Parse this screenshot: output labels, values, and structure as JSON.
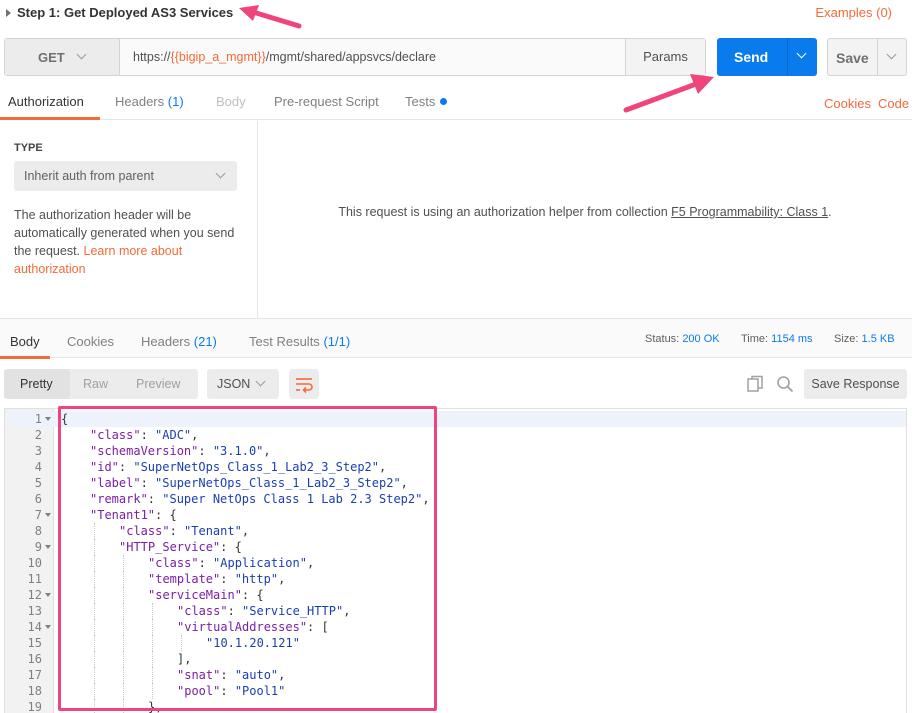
{
  "request": {
    "title": "Step 1: Get Deployed AS3 Services",
    "examples_label": "Examples (0)",
    "method": "GET",
    "url_prefix": "https://",
    "url_variable": "{{bigip_a_mgmt}}",
    "url_suffix": "/mgmt/shared/appsvcs/declare",
    "params_label": "Params",
    "send_label": "Send",
    "save_label": "Save"
  },
  "request_tabs": {
    "authorization": "Authorization",
    "headers": "Headers",
    "headers_count": "(1)",
    "body": "Body",
    "pre_request": "Pre-request Script",
    "tests": "Tests",
    "cookies": "Cookies",
    "code": "Code"
  },
  "auth": {
    "type_label": "TYPE",
    "selected": "Inherit auth from parent",
    "description": "The authorization header will be automatically generated when you send the request. ",
    "learn_more": "Learn more about authorization",
    "helper_message": "This request is using an authorization helper from collection ",
    "collection_name": "F5 Programmability: Class 1",
    "helper_suffix": "."
  },
  "response_tabs": {
    "body": "Body",
    "cookies": "Cookies",
    "headers": "Headers",
    "headers_count": "(21)",
    "test_results": "Test Results",
    "test_results_count": "(1/1)"
  },
  "response_status": {
    "status_label": "Status:",
    "status_value": "200 OK",
    "time_label": "Time:",
    "time_value": "1154 ms",
    "size_label": "Size:",
    "size_value": "1.5 KB"
  },
  "body_toolbar": {
    "pretty": "Pretty",
    "raw": "Raw",
    "preview": "Preview",
    "format": "JSON",
    "save_response": "Save Response"
  },
  "code_lines": [
    {
      "n": "1",
      "fold": true,
      "indent": 0,
      "parts": [
        [
          "p",
          "{"
        ]
      ]
    },
    {
      "n": "2",
      "fold": false,
      "indent": 1,
      "parts": [
        [
          "k",
          "\"class\""
        ],
        [
          "p",
          ": "
        ],
        [
          "s",
          "\"ADC\""
        ],
        [
          "p",
          ","
        ]
      ]
    },
    {
      "n": "3",
      "fold": false,
      "indent": 1,
      "parts": [
        [
          "k",
          "\"schemaVersion\""
        ],
        [
          "p",
          ": "
        ],
        [
          "s",
          "\"3.1.0\""
        ],
        [
          "p",
          ","
        ]
      ]
    },
    {
      "n": "4",
      "fold": false,
      "indent": 1,
      "parts": [
        [
          "k",
          "\"id\""
        ],
        [
          "p",
          ": "
        ],
        [
          "s",
          "\"SuperNetOps_Class_1_Lab2_3_Step2\""
        ],
        [
          "p",
          ","
        ]
      ]
    },
    {
      "n": "5",
      "fold": false,
      "indent": 1,
      "parts": [
        [
          "k",
          "\"label\""
        ],
        [
          "p",
          ": "
        ],
        [
          "s",
          "\"SuperNetOps_Class_1_Lab2_3_Step2\""
        ],
        [
          "p",
          ","
        ]
      ]
    },
    {
      "n": "6",
      "fold": false,
      "indent": 1,
      "parts": [
        [
          "k",
          "\"remark\""
        ],
        [
          "p",
          ": "
        ],
        [
          "s",
          "\"Super NetOps Class 1 Lab 2.3 Step2\""
        ],
        [
          "p",
          ","
        ]
      ]
    },
    {
      "n": "7",
      "fold": true,
      "indent": 1,
      "parts": [
        [
          "k",
          "\"Tenant1\""
        ],
        [
          "p",
          ": {"
        ]
      ]
    },
    {
      "n": "8",
      "fold": false,
      "indent": 2,
      "parts": [
        [
          "k",
          "\"class\""
        ],
        [
          "p",
          ": "
        ],
        [
          "s",
          "\"Tenant\""
        ],
        [
          "p",
          ","
        ]
      ]
    },
    {
      "n": "9",
      "fold": true,
      "indent": 2,
      "parts": [
        [
          "k",
          "\"HTTP_Service\""
        ],
        [
          "p",
          ": {"
        ]
      ]
    },
    {
      "n": "10",
      "fold": false,
      "indent": 3,
      "parts": [
        [
          "k",
          "\"class\""
        ],
        [
          "p",
          ": "
        ],
        [
          "s",
          "\"Application\""
        ],
        [
          "p",
          ","
        ]
      ]
    },
    {
      "n": "11",
      "fold": false,
      "indent": 3,
      "parts": [
        [
          "k",
          "\"template\""
        ],
        [
          "p",
          ": "
        ],
        [
          "s",
          "\"http\""
        ],
        [
          "p",
          ","
        ]
      ]
    },
    {
      "n": "12",
      "fold": true,
      "indent": 3,
      "parts": [
        [
          "k",
          "\"serviceMain\""
        ],
        [
          "p",
          ": {"
        ]
      ]
    },
    {
      "n": "13",
      "fold": false,
      "indent": 4,
      "parts": [
        [
          "k",
          "\"class\""
        ],
        [
          "p",
          ": "
        ],
        [
          "s",
          "\"Service_HTTP\""
        ],
        [
          "p",
          ","
        ]
      ]
    },
    {
      "n": "14",
      "fold": true,
      "indent": 4,
      "parts": [
        [
          "k",
          "\"virtualAddresses\""
        ],
        [
          "p",
          ": ["
        ]
      ]
    },
    {
      "n": "15",
      "fold": false,
      "indent": 5,
      "parts": [
        [
          "s",
          "\"10.1.20.121\""
        ]
      ]
    },
    {
      "n": "16",
      "fold": false,
      "indent": 4,
      "parts": [
        [
          "p",
          "],"
        ]
      ]
    },
    {
      "n": "17",
      "fold": false,
      "indent": 4,
      "parts": [
        [
          "k",
          "\"snat\""
        ],
        [
          "p",
          ": "
        ],
        [
          "s",
          "\"auto\""
        ],
        [
          "p",
          ","
        ]
      ]
    },
    {
      "n": "18",
      "fold": false,
      "indent": 4,
      "parts": [
        [
          "k",
          "\"pool\""
        ],
        [
          "p",
          ": "
        ],
        [
          "s",
          "\"Pool1\""
        ]
      ]
    },
    {
      "n": "19",
      "fold": false,
      "indent": 3,
      "parts": [
        [
          "p",
          "},"
        ]
      ]
    }
  ],
  "colors": {
    "accent": "#f26b3a",
    "send": "#097bed",
    "annotation": "#f0457a"
  }
}
